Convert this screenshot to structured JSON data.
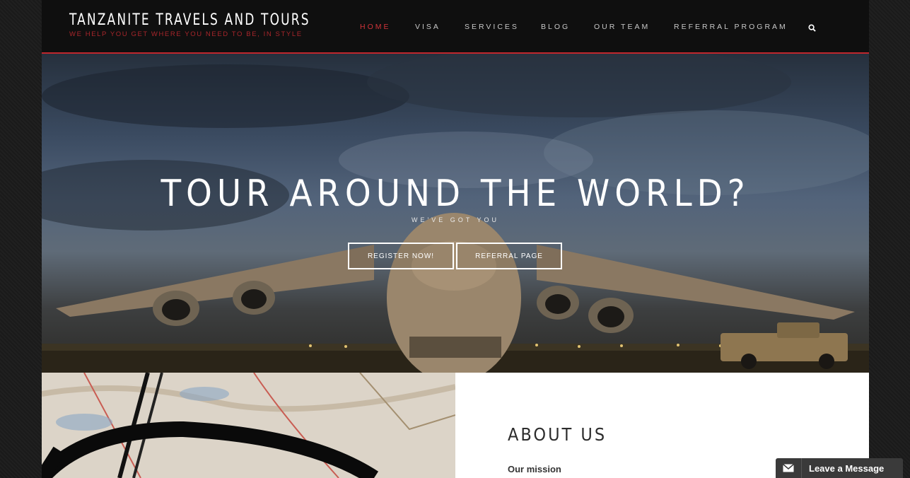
{
  "brand": {
    "title": "TANZANITE TRAVELS AND TOURS",
    "tagline": "WE HELP YOU GET WHERE YOU NEED TO BE, IN STYLE"
  },
  "nav": {
    "items": [
      {
        "label": "HOME",
        "active": true
      },
      {
        "label": "VISA",
        "active": false
      },
      {
        "label": "SERVICES",
        "active": false
      },
      {
        "label": "BLOG",
        "active": false
      },
      {
        "label": "OUR TEAM",
        "active": false
      },
      {
        "label": "REFERRAL PROGRAM",
        "active": false
      }
    ],
    "search_icon": "search-icon"
  },
  "hero": {
    "title": "TOUR AROUND THE WORLD?",
    "subtitle": "WE'VE GOT YOU",
    "register_label": "REGISTER NOW!",
    "referral_label": "REFERRAL PAGE"
  },
  "about": {
    "title": "ABOUT US",
    "mission_label": "Our mission"
  },
  "chat": {
    "label": "Leave a Message",
    "icon": "envelope-icon"
  },
  "colors": {
    "accent": "#c0272d",
    "header_bg": "#0f0f0f"
  }
}
